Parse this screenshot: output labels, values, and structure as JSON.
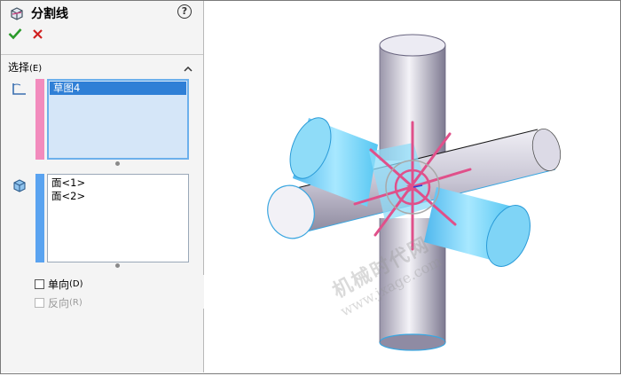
{
  "panel": {
    "title": "分割线",
    "help_symbol": "?",
    "confirm_icon": "check-icon",
    "cancel_icon": "x-icon",
    "section": {
      "label": "选择",
      "hotkey": "(E)"
    },
    "sketch_list": {
      "items": [
        "草图4"
      ],
      "selected_index": 0
    },
    "faces_list": {
      "items": [
        "面<1>",
        "面<2>"
      ]
    },
    "options": [
      {
        "label": "单向",
        "hotkey": "(D)",
        "checked": false,
        "enabled": true
      },
      {
        "label": "反向",
        "hotkey": "(R)",
        "checked": false,
        "enabled": false
      }
    ]
  },
  "viewport": {
    "watermark_line1": "机械时代网",
    "watermark_line2": "www.jxage.com"
  },
  "colors": {
    "accent_pink": "#f28bbd",
    "accent_blue": "#5aa3f0",
    "selected_face": "#7fd8f7",
    "sketch_lines": "#e0508a",
    "confirm_green": "#2a9a2a",
    "cancel_red": "#d02020"
  }
}
